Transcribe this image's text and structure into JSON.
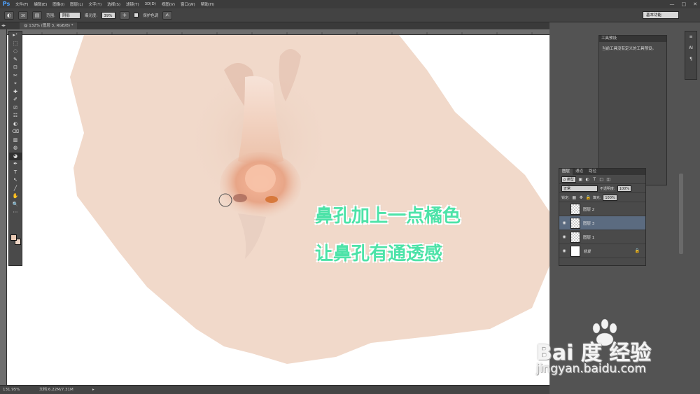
{
  "app": {
    "logo": "Ps"
  },
  "menu": [
    "文件(F)",
    "编辑(E)",
    "图像(I)",
    "图层(L)",
    "文字(Y)",
    "选择(S)",
    "滤镜(T)",
    "3D(D)",
    "视图(V)",
    "窗口(W)",
    "帮助(H)"
  ],
  "window_controls": {
    "minimize": "—",
    "maximize": "□",
    "close": "✕"
  },
  "options": {
    "size": "30",
    "range_label": "范围:",
    "range_value": "阴影",
    "exposure_label": "曝光度:",
    "exposure_value": "39%",
    "protect_label": "保护色调",
    "workspace": "基本功能"
  },
  "document": {
    "tab": "@ 132% (图层 3, RGB/8) *"
  },
  "tools": [
    "▸⁺",
    "⬚",
    "◌",
    "✎",
    "⊡",
    "✂",
    "⌖",
    "✚",
    "✐",
    "⎚",
    "☷",
    "◐",
    "⌫",
    "▥",
    "◍",
    "◕",
    "✒",
    "T",
    "↖",
    "╱",
    "✋",
    "🔍",
    "⋯"
  ],
  "status": {
    "zoom": "131.95%",
    "doc": "文档:6.22M/7.31M",
    "arrow": "▸"
  },
  "info_panel": {
    "title": "工具预设",
    "text": "当前工具没有定义的工具预设。"
  },
  "right_icons": [
    "≡",
    "AI",
    "¶"
  ],
  "layers_panel": {
    "tabs": [
      "图层",
      "通道",
      "路径"
    ],
    "kind": "ρ 类型",
    "blend": "正常",
    "opacity_label": "不透明度:",
    "opacity": "100%",
    "lock_label": "锁定:",
    "fill_label": "填充:",
    "fill": "100%",
    "layers": [
      {
        "name": "图层 2",
        "visible": false,
        "selected": false
      },
      {
        "name": "图层 3",
        "visible": true,
        "selected": true
      },
      {
        "name": "图层 1",
        "visible": true,
        "selected": false
      },
      {
        "name": "背景",
        "visible": true,
        "selected": false
      }
    ]
  },
  "annotations": {
    "line1": "鼻孔加上一点橘色",
    "line2": "让鼻孔有通透感"
  },
  "watermark": {
    "logo": "Bai 度 经验",
    "url": "jingyan.baidu.com"
  }
}
